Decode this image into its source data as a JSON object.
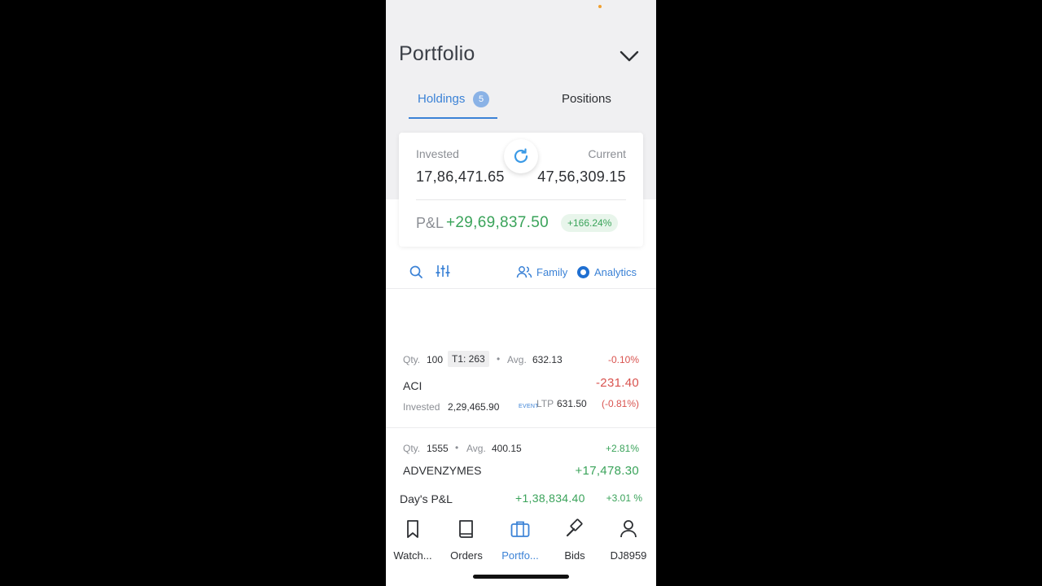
{
  "header": {
    "title": "Portfolio"
  },
  "tabs": {
    "holdings_label": "Holdings",
    "holdings_count": "5",
    "positions_label": "Positions"
  },
  "summary": {
    "invested_label": "Invested",
    "invested_value": "17,86,471.65",
    "current_label": "Current",
    "current_value": "47,56,309.15",
    "pnl_label": "P&L",
    "pnl_value": "+29,69,837.50",
    "pnl_pct": "+166.24%"
  },
  "toolbar": {
    "family_label": "Family",
    "analytics_label": "Analytics"
  },
  "holdings": [
    {
      "qty_label": "Qty.",
      "qty": "100",
      "t1": "T1: 263",
      "avg_label": "Avg.",
      "avg": "632.13",
      "pct": "-0.10%",
      "symbol": "ACI",
      "pnl": "-231.40",
      "invested_label": "Invested",
      "invested": "2,29,465.90",
      "event": "EVENT",
      "ltp_label": "LTP",
      "ltp": "631.50",
      "ltp_change": "(-0.81%)"
    },
    {
      "qty_label": "Qty.",
      "qty": "1555",
      "avg_label": "Avg.",
      "avg": "400.15",
      "pct": "+2.81%",
      "symbol": "ADVENZYMES",
      "pnl": "+17,478.30"
    }
  ],
  "days_pnl": {
    "label": "Day's P&L",
    "value": "+1,38,834.40",
    "pct": "+3.01 %"
  },
  "bottom_nav": [
    {
      "label": "Watch...",
      "icon": "bookmark-icon"
    },
    {
      "label": "Orders",
      "icon": "book-icon"
    },
    {
      "label": "Portfo...",
      "icon": "briefcase-icon"
    },
    {
      "label": "Bids",
      "icon": "gavel-icon"
    },
    {
      "label": "DJ8959",
      "icon": "user-icon"
    }
  ],
  "colors": {
    "accent": "#3b82d6",
    "profit": "#3aa35a",
    "loss": "#d9534f"
  }
}
